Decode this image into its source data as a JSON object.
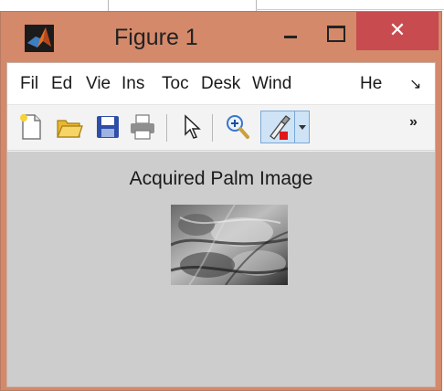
{
  "window": {
    "title": "Figure 1",
    "close_glyph": "✕",
    "controls": [
      "minimize-icon",
      "maximize-icon",
      "close-icon"
    ]
  },
  "menubar": {
    "items": [
      "Fil",
      "Ed",
      "Vie",
      "Ins",
      "Toc",
      "Desk",
      "Wind",
      "He"
    ],
    "overflow_glyph": "↘"
  },
  "toolbar": {
    "icons": [
      "new-figure-icon",
      "open-folder-icon",
      "save-icon",
      "print-icon",
      "pointer-icon",
      "zoom-in-icon",
      "brush-icon",
      "dropdown-arrow-icon"
    ],
    "overflow_glyph": "»"
  },
  "figure": {
    "axes_title": "Acquired Palm Image",
    "image": "grayscale palm texture"
  },
  "colors": {
    "frame": "#d4896a",
    "close": "#c74b4f",
    "figure_bg": "#cdcdcd"
  }
}
